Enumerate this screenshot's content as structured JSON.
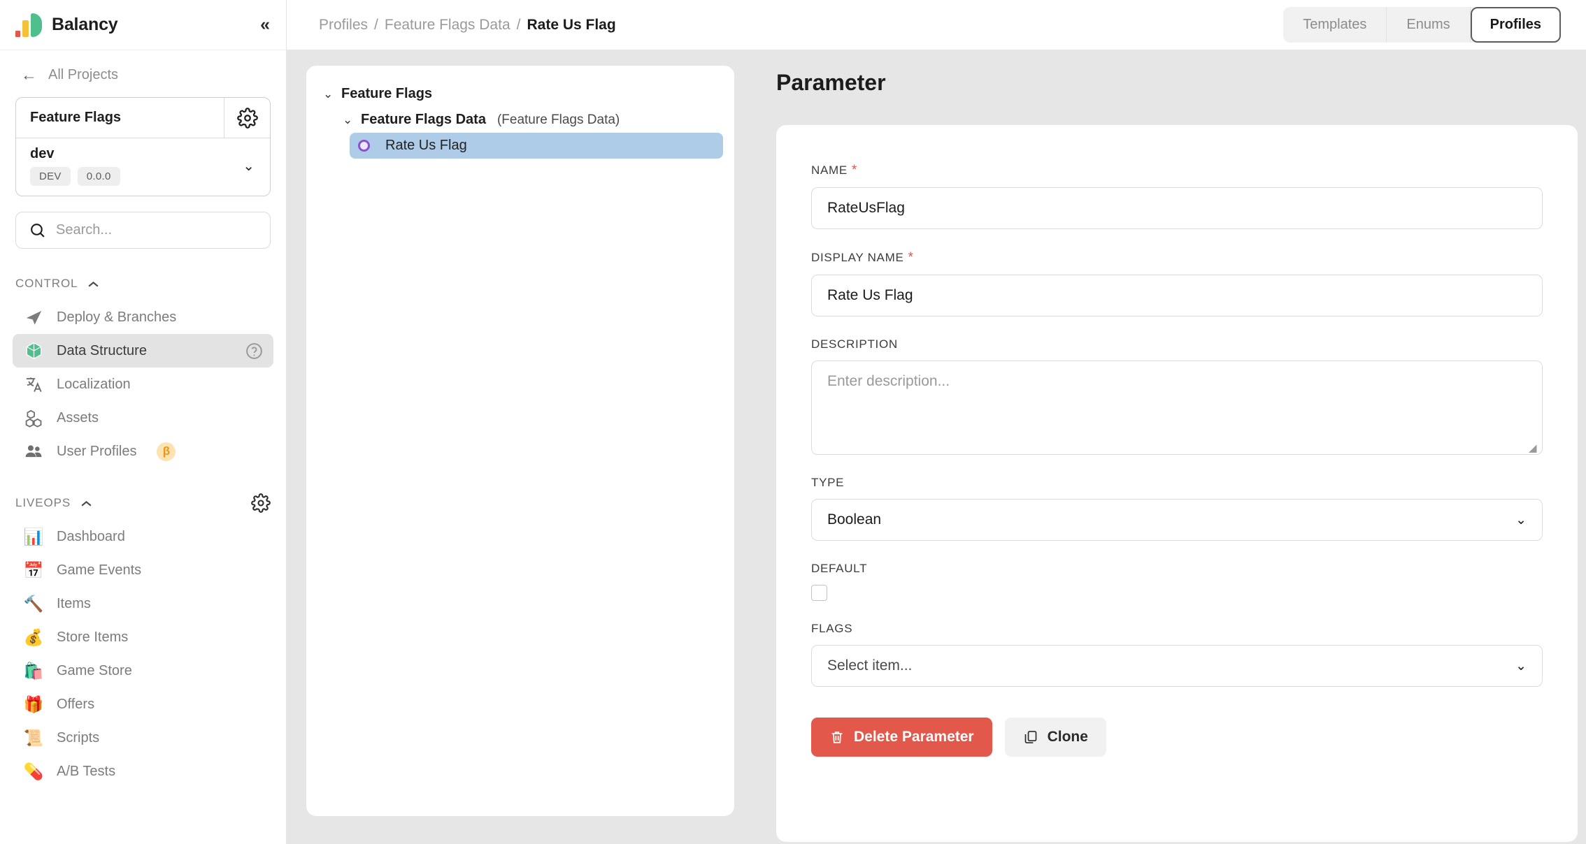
{
  "brand": {
    "name": "Balancy",
    "collapse_label": "«"
  },
  "sidebar": {
    "all_projects": "All Projects",
    "project": {
      "name": "Feature Flags",
      "env_name": "dev",
      "chips": [
        "DEV",
        "0.0.0"
      ]
    },
    "search_placeholder": "Search...",
    "sections": [
      {
        "title": "CONTROL",
        "items": [
          {
            "label": "Deploy & Branches",
            "icon": "paper-plane-icon",
            "active": false
          },
          {
            "label": "Data Structure",
            "icon": "cube-icon",
            "active": true,
            "help": true
          },
          {
            "label": "Localization",
            "icon": "translate-icon",
            "active": false
          },
          {
            "label": "Assets",
            "icon": "blocks-icon",
            "active": false
          },
          {
            "label": "User Profiles",
            "icon": "users-icon",
            "active": false,
            "badge": "β"
          }
        ]
      },
      {
        "title": "LIVEOPS",
        "gear": true,
        "items": [
          {
            "label": "Dashboard",
            "emoji": "📊"
          },
          {
            "label": "Game Events",
            "emoji": "📅"
          },
          {
            "label": "Items",
            "emoji": "🔨"
          },
          {
            "label": "Store Items",
            "emoji": "💰"
          },
          {
            "label": "Game Store",
            "emoji": "🛍️"
          },
          {
            "label": "Offers",
            "emoji": "🎁"
          },
          {
            "label": "Scripts",
            "emoji": "📜"
          },
          {
            "label": "A/B Tests",
            "emoji": "💊"
          }
        ]
      }
    ]
  },
  "topbar": {
    "breadcrumb": [
      "Profiles",
      "Feature Flags Data",
      "Rate Us Flag"
    ],
    "separator": "/",
    "tabs": [
      {
        "label": "Templates",
        "active": false
      },
      {
        "label": "Enums",
        "active": false
      },
      {
        "label": "Profiles",
        "active": true
      }
    ]
  },
  "tree": {
    "root": {
      "label": "Feature Flags",
      "caret": "⌄"
    },
    "child": {
      "label": "Feature Flags Data",
      "sub": "(Feature Flags Data)",
      "caret": "⌄"
    },
    "leaf": {
      "label": "Rate Us Flag",
      "selected": true
    }
  },
  "parameter": {
    "title": "Parameter",
    "fields": {
      "name": {
        "label": "NAME",
        "required": true,
        "value": "RateUsFlag"
      },
      "display_name": {
        "label": "DISPLAY NAME",
        "required": true,
        "value": "Rate Us Flag"
      },
      "description": {
        "label": "DESCRIPTION",
        "required": false,
        "value": "",
        "placeholder": "Enter description..."
      },
      "type": {
        "label": "TYPE",
        "required": false,
        "value": "Boolean"
      },
      "default": {
        "label": "DEFAULT",
        "required": false,
        "checked": false
      },
      "flags": {
        "label": "FLAGS",
        "required": false,
        "value": "Select item..."
      }
    },
    "buttons": {
      "delete": "Delete Parameter",
      "clone": "Clone"
    }
  },
  "colors": {
    "accent_green": "#4fc08d",
    "danger": "#e2584a",
    "selection_blue": "#aecbe8",
    "purple_dot": "#8754c9",
    "beta_orange": "#e8961f"
  }
}
